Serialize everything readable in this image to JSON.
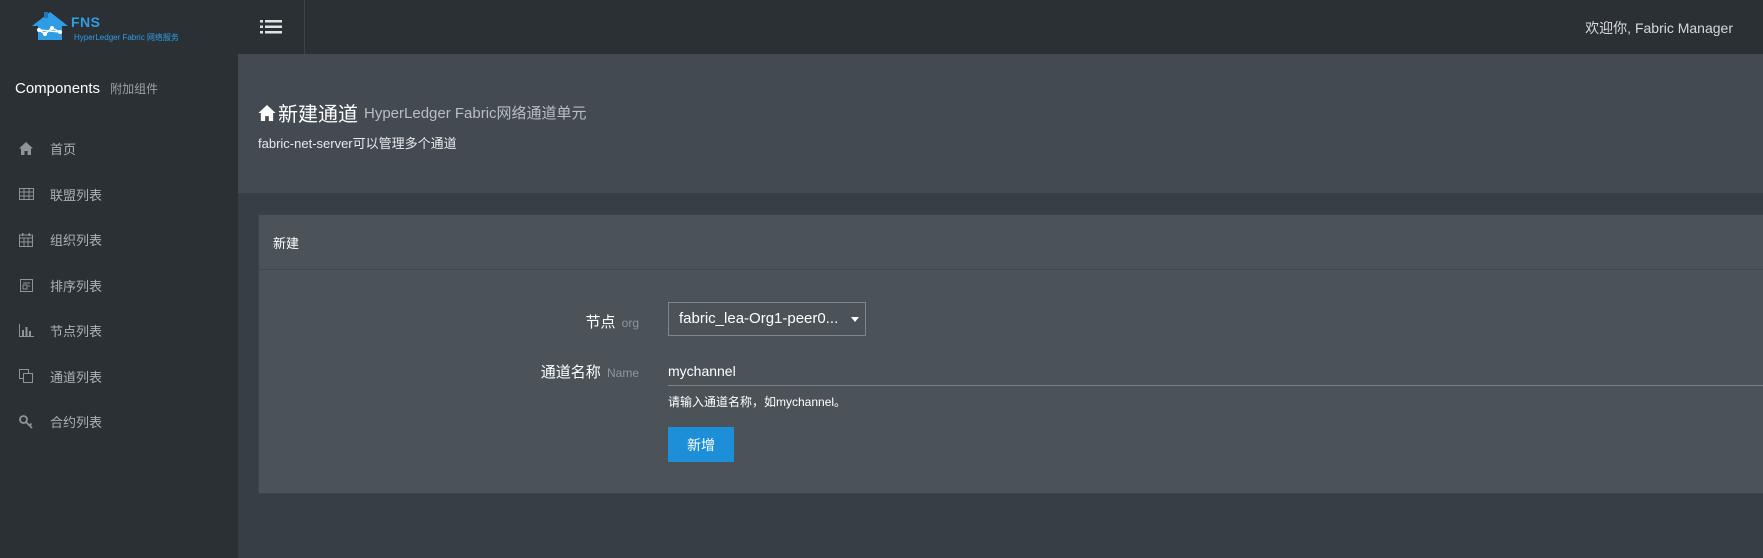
{
  "brand": {
    "name": "FNS",
    "subtitle": "HyperLedger Fabric 网络服务",
    "color": "#2f9de4"
  },
  "sidebar": {
    "heading": "Components",
    "heading_small": "附加组件",
    "items": [
      {
        "label": "首页",
        "icon": "home-icon"
      },
      {
        "label": "联盟列表",
        "icon": "table-icon"
      },
      {
        "label": "组织列表",
        "icon": "calendar-icon"
      },
      {
        "label": "排序列表",
        "icon": "list-box-icon"
      },
      {
        "label": "节点列表",
        "icon": "bar-chart-icon"
      },
      {
        "label": "通道列表",
        "icon": "copy-icon"
      },
      {
        "label": "合约列表",
        "icon": "key-icon"
      }
    ]
  },
  "topbar": {
    "toggle_icon": "list-icon",
    "welcome": "欢迎你, Fabric Manager"
  },
  "header": {
    "title": "新建通道",
    "subtitle": "HyperLedger Fabric网络通道单元",
    "description": "fabric-net-server可以管理多个通道"
  },
  "panel": {
    "title": "新建",
    "node_label": "节点",
    "node_hint": "org",
    "node_value": "fabric_lea-Org1-peer0...",
    "name_label": "通道名称",
    "name_hint": "Name",
    "name_value": "mychannel",
    "help_text": "请输入通道名称，如mychannel。",
    "submit_label": "新增"
  },
  "colors": {
    "accent": "#1d8fd8",
    "sidebar_bg": "#2b3035"
  }
}
